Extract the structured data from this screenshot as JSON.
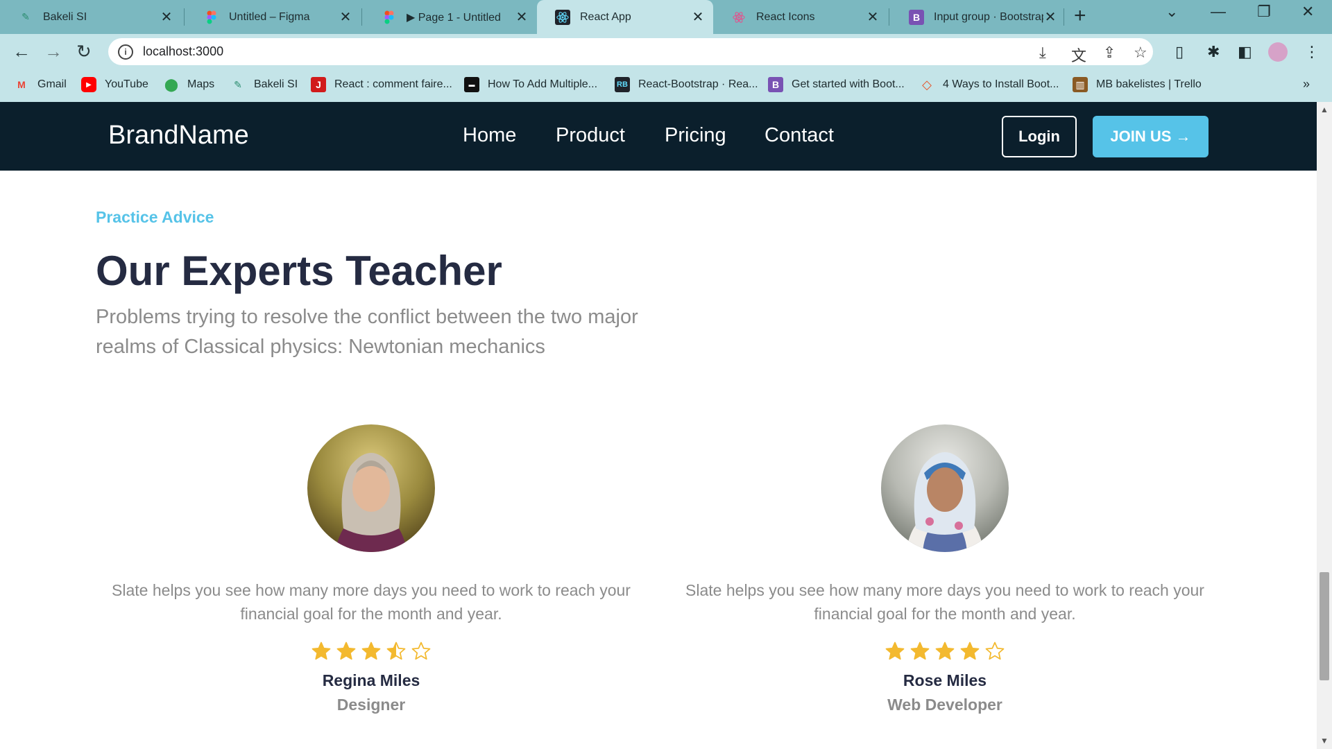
{
  "browser": {
    "tabs": [
      {
        "title": "Bakeli SI",
        "favicon": "bakeli",
        "active": false
      },
      {
        "title": "Untitled – Figma",
        "favicon": "figma",
        "active": false
      },
      {
        "title": "▶ Page 1 - Untitled",
        "favicon": "figma",
        "active": false
      },
      {
        "title": "React App",
        "favicon": "react",
        "active": true
      },
      {
        "title": "React Icons",
        "favicon": "react-icons",
        "active": false
      },
      {
        "title": "Input group · Bootstrap",
        "favicon": "bootstrap",
        "active": false
      }
    ],
    "url": "localhost:3000",
    "bookmarks": [
      {
        "label": "Gmail",
        "icon": "gmail"
      },
      {
        "label": "YouTube",
        "icon": "youtube"
      },
      {
        "label": "Maps",
        "icon": "maps"
      },
      {
        "label": "Bakeli SI",
        "icon": "bakeli"
      },
      {
        "label": "React : comment faire...",
        "icon": "j"
      },
      {
        "label": "How To Add Multiple...",
        "icon": "dark"
      },
      {
        "label": "React-Bootstrap · Rea...",
        "icon": "rb"
      },
      {
        "label": "Get started with Boot...",
        "icon": "bootstrap"
      },
      {
        "label": "4 Ways to Install Boot...",
        "icon": "diamond"
      },
      {
        "label": "MB bakelistes | Trello",
        "icon": "trello"
      }
    ]
  },
  "site": {
    "brand": "BrandName",
    "menu": [
      "Home",
      "Product",
      "Pricing",
      "Contact"
    ],
    "login_label": "Login",
    "join_label": "JOIN US →",
    "eyebrow": "Practice Advice",
    "heading": "Our Experts Teacher",
    "lead": "Problems trying to resolve the conflict between the two major realms of Classical physics: Newtonian mechanics",
    "teachers": [
      {
        "quote": "Slate helps you see how many more days you need to work to reach your financial goal for the month and year.",
        "rating": 3.5,
        "name": "Regina Miles",
        "role": "Designer"
      },
      {
        "quote": "Slate helps you see how many more days you need to work to reach your financial goal for the month and year.",
        "rating": 4,
        "name": "Rose Miles",
        "role": "Web Developer"
      }
    ]
  },
  "colors": {
    "accent": "#56c3e8",
    "nav_bg": "#0b1f2c",
    "star": "#f3b92f",
    "heading": "#252b42",
    "muted": "#8b8b8b"
  }
}
